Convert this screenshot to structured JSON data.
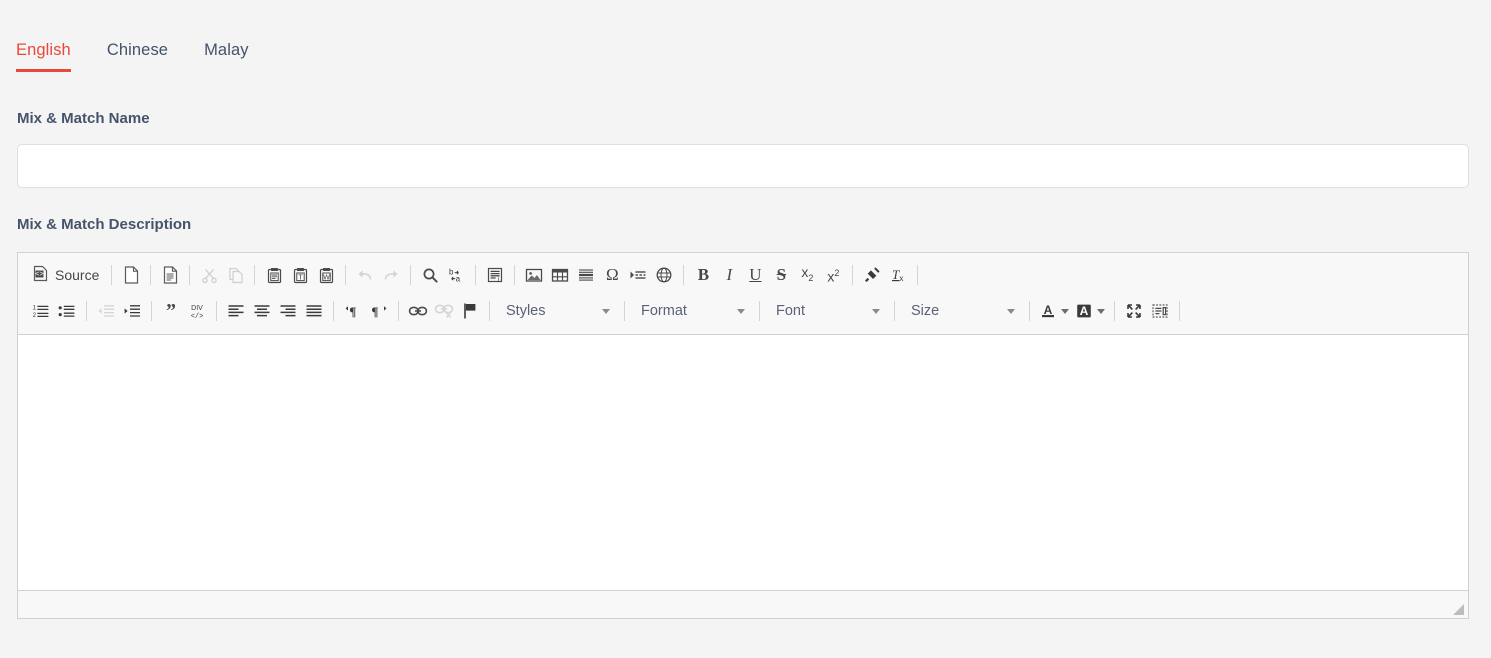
{
  "tabs": [
    {
      "label": "English",
      "active": true
    },
    {
      "label": "Chinese",
      "active": false
    },
    {
      "label": "Malay",
      "active": false
    }
  ],
  "fields": {
    "name_label": "Mix & Match Name",
    "name_value": "",
    "name_placeholder": "",
    "description_label": "Mix & Match Description",
    "description_value": ""
  },
  "editor": {
    "source_label": "Source",
    "combos": [
      {
        "name": "styles",
        "label": "Styles"
      },
      {
        "name": "format",
        "label": "Format"
      },
      {
        "name": "font",
        "label": "Font"
      },
      {
        "name": "size",
        "label": "Size"
      }
    ],
    "row1_buttons": [
      {
        "name": "source-button",
        "title": "Source",
        "disabled": false
      },
      {
        "name": "new-page-icon",
        "title": "New Page",
        "disabled": false
      },
      {
        "name": "templates-icon",
        "title": "Templates",
        "disabled": false
      },
      {
        "name": "cut-icon",
        "title": "Cut",
        "disabled": true
      },
      {
        "name": "copy-icon",
        "title": "Copy",
        "disabled": true
      },
      {
        "name": "paste-icon",
        "title": "Paste",
        "disabled": false
      },
      {
        "name": "paste-as-plain-text-icon",
        "title": "Paste as plain text",
        "disabled": false
      },
      {
        "name": "paste-from-word-icon",
        "title": "Paste from Word",
        "disabled": false
      },
      {
        "name": "undo-icon",
        "title": "Undo",
        "disabled": true
      },
      {
        "name": "redo-icon",
        "title": "Redo",
        "disabled": true
      },
      {
        "name": "find-icon",
        "title": "Find",
        "disabled": false
      },
      {
        "name": "replace-icon",
        "title": "Replace",
        "disabled": false
      },
      {
        "name": "select-all-icon",
        "title": "Select All",
        "disabled": false
      },
      {
        "name": "image-icon",
        "title": "Image",
        "disabled": false
      },
      {
        "name": "table-icon",
        "title": "Table",
        "disabled": false
      },
      {
        "name": "horizontal-rule-icon",
        "title": "Horizontal Line",
        "disabled": false
      },
      {
        "name": "special-character-icon",
        "title": "Insert Special Character",
        "disabled": false
      },
      {
        "name": "page-break-icon",
        "title": "Page Break",
        "disabled": false
      },
      {
        "name": "iframe-icon",
        "title": "IFrame",
        "disabled": false
      },
      {
        "name": "bold-icon",
        "title": "Bold",
        "disabled": false
      },
      {
        "name": "italic-icon",
        "title": "Italic",
        "disabled": false
      },
      {
        "name": "underline-icon",
        "title": "Underline",
        "disabled": false
      },
      {
        "name": "strikethrough-icon",
        "title": "Strikethrough",
        "disabled": false
      },
      {
        "name": "subscript-icon",
        "title": "Subscript",
        "disabled": false
      },
      {
        "name": "superscript-icon",
        "title": "Superscript",
        "disabled": false
      },
      {
        "name": "copy-formatting-icon",
        "title": "Copy Formatting",
        "disabled": false
      },
      {
        "name": "remove-format-icon",
        "title": "Remove Format",
        "disabled": false
      }
    ],
    "row2_buttons": [
      {
        "name": "numbered-list-icon",
        "title": "Insert/Remove Numbered List",
        "disabled": false
      },
      {
        "name": "bulleted-list-icon",
        "title": "Insert/Remove Bulleted List",
        "disabled": false
      },
      {
        "name": "decrease-indent-icon",
        "title": "Decrease Indent",
        "disabled": true
      },
      {
        "name": "increase-indent-icon",
        "title": "Increase Indent",
        "disabled": false
      },
      {
        "name": "blockquote-icon",
        "title": "Block Quote",
        "disabled": false
      },
      {
        "name": "div-container-icon",
        "title": "Create Div Container",
        "disabled": false
      },
      {
        "name": "align-left-icon",
        "title": "Align Left",
        "disabled": false
      },
      {
        "name": "align-center-icon",
        "title": "Center",
        "disabled": false
      },
      {
        "name": "align-right-icon",
        "title": "Align Right",
        "disabled": false
      },
      {
        "name": "justify-icon",
        "title": "Justify",
        "disabled": false
      },
      {
        "name": "text-direction-ltr-icon",
        "title": "Text direction from left to right",
        "disabled": false
      },
      {
        "name": "text-direction-rtl-icon",
        "title": "Text direction from right to left",
        "disabled": false
      },
      {
        "name": "link-icon",
        "title": "Link",
        "disabled": false
      },
      {
        "name": "unlink-icon",
        "title": "Unlink",
        "disabled": true
      },
      {
        "name": "anchor-icon",
        "title": "Anchor",
        "disabled": false
      },
      {
        "name": "text-color-icon",
        "title": "Text Color",
        "disabled": false
      },
      {
        "name": "background-color-icon",
        "title": "Background Color",
        "disabled": false
      },
      {
        "name": "maximize-icon",
        "title": "Maximize",
        "disabled": false
      },
      {
        "name": "show-blocks-icon",
        "title": "Show Blocks",
        "disabled": false
      }
    ],
    "status_text": ""
  },
  "colors": {
    "accent": "#e8493a",
    "label": "#46536a",
    "page_background": "#f4f4f4",
    "toolbar_background": "#f8f8f8",
    "border": "#d1d1d1"
  }
}
